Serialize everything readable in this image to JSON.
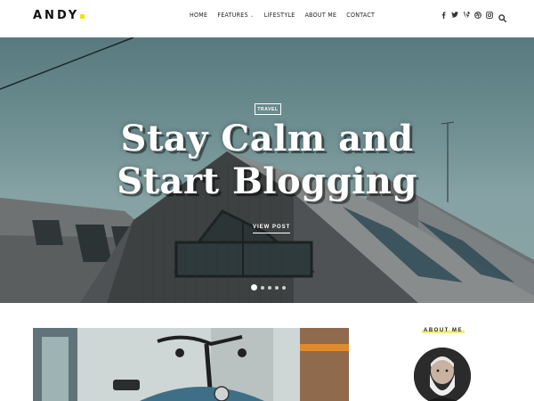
{
  "header": {
    "logo": "ANDY",
    "nav": [
      {
        "label": "HOME"
      },
      {
        "label": "FEATURES",
        "has_dropdown": true
      },
      {
        "label": "LIFESTYLE"
      },
      {
        "label": "ABOUT ME"
      },
      {
        "label": "CONTACT"
      }
    ],
    "social_icons": [
      "facebook-icon",
      "twitter-icon",
      "vine-icon",
      "dribbble-icon",
      "instagram-icon"
    ],
    "accent_color": "#f2e400"
  },
  "hero": {
    "category": "TRAVEL",
    "title_line1": "Stay Calm and",
    "title_line2": "Start Blogging",
    "cta": "VIEW POST",
    "slides": 5,
    "active_slide": 1
  },
  "sidebar": {
    "about_title": "ABOUT ME"
  }
}
